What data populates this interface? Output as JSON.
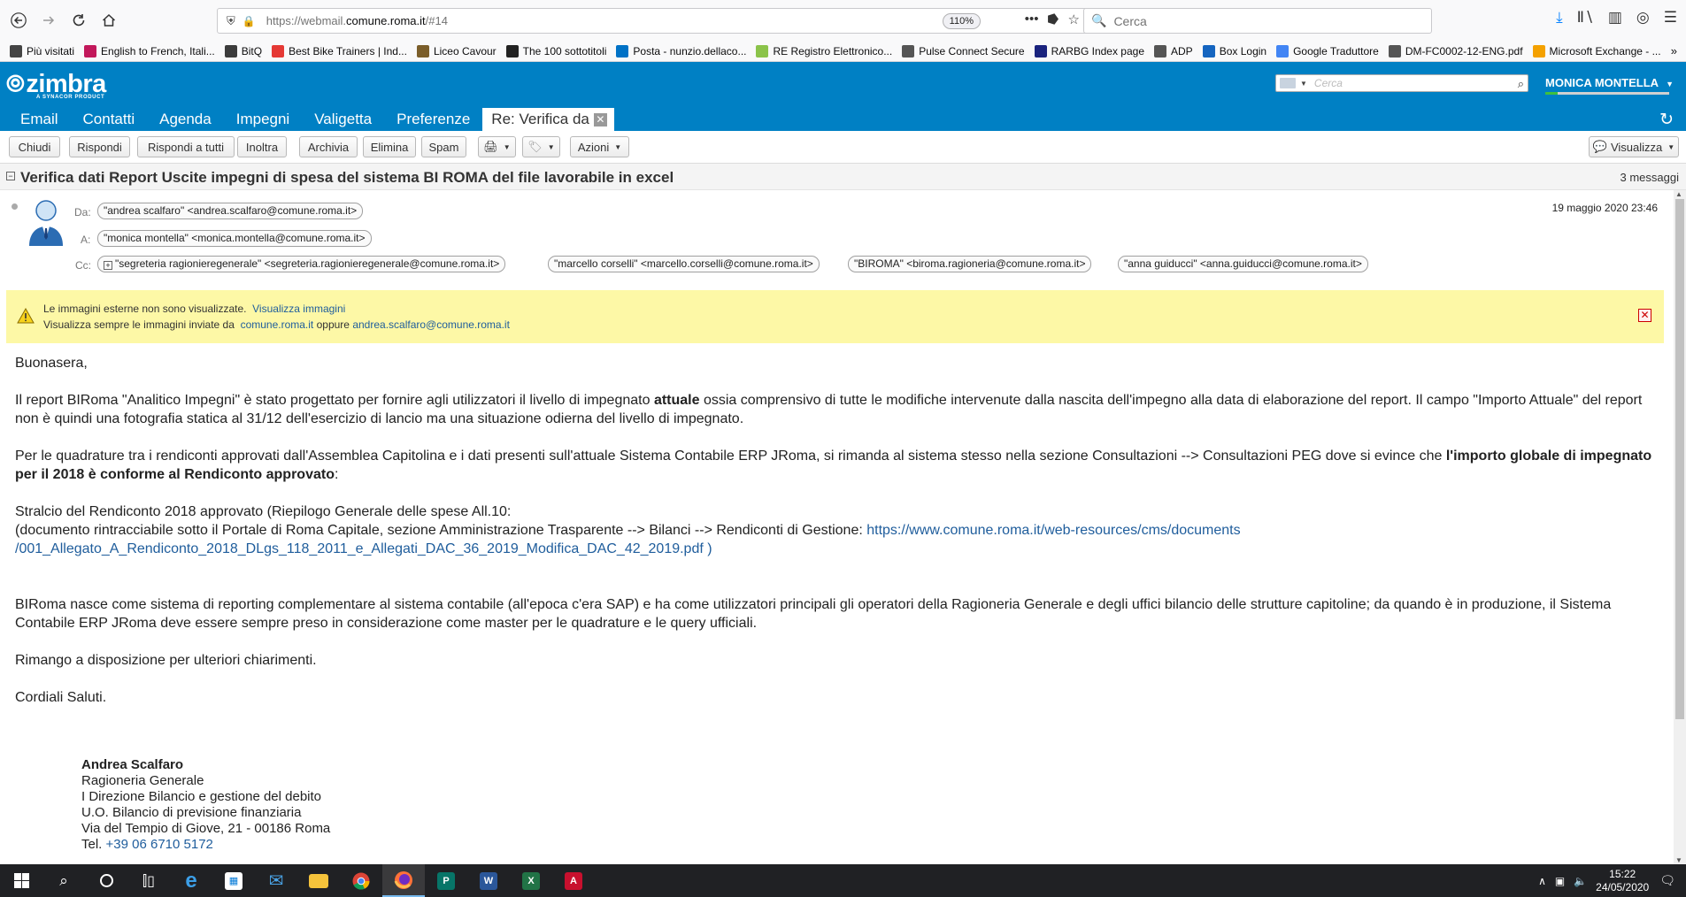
{
  "browser": {
    "url_prefix": "https://webmail.",
    "url_domain": "comune.roma.it",
    "url_suffix": "/#14",
    "zoom": "110%",
    "search_placeholder": "Cerca"
  },
  "bookmarks": [
    {
      "label": "Più visitati",
      "icon_color": "#444444"
    },
    {
      "label": "English to French, Itali...",
      "icon_color": "#c2185b"
    },
    {
      "label": "BitQ",
      "icon_color": "#3c3c3c"
    },
    {
      "label": "Best Bike Trainers | Ind...",
      "icon_color": "#e53935"
    },
    {
      "label": "Liceo Cavour",
      "icon_color": "#7b5e2a"
    },
    {
      "label": "The 100 sottotitoli",
      "icon_color": "#222222"
    },
    {
      "label": "Posta - nunzio.dellaco...",
      "icon_color": "#0072c6"
    },
    {
      "label": "RE Registro Elettronico...",
      "icon_color": "#8bc34a"
    },
    {
      "label": "Pulse Connect Secure",
      "icon_color": "#555555"
    },
    {
      "label": "RARBG Index page",
      "icon_color": "#1a237e"
    },
    {
      "label": "ADP",
      "icon_color": "#555555"
    },
    {
      "label": "Box Login",
      "icon_color": "#1565c0"
    },
    {
      "label": "Google Traduttore",
      "icon_color": "#4285f4"
    },
    {
      "label": "DM-FC0002-12-ENG.pdf",
      "icon_color": "#555555"
    },
    {
      "label": "Microsoft Exchange - ...",
      "icon_color": "#f4a100"
    }
  ],
  "zimbra": {
    "logo": "zimbra",
    "logo_sub": "A SYNACOR PRODUCT",
    "search_placeholder": "Cerca",
    "user": "MONICA MONTELLA",
    "tabs": [
      "Email",
      "Contatti",
      "Agenda",
      "Impegni",
      "Valigetta",
      "Preferenze"
    ],
    "active_tab": "Re: Verifica da",
    "actions": [
      "Chiudi",
      "Rispondi",
      "Rispondi a tutti",
      "Inoltra",
      "Archivia",
      "Elimina",
      "Spam"
    ],
    "azioni": "Azioni",
    "visualizza": "Visualizza"
  },
  "conversation": {
    "subject": "Verifica dati Report Uscite impegni di spesa del sistema BI ROMA del file lavorabile in excel",
    "count": "3 messaggi",
    "labels": {
      "from": "Da:",
      "to": "A:",
      "cc": "Cc:"
    },
    "from": "\"andrea scalfaro\" <andrea.scalfaro@comune.roma.it>",
    "to": "\"monica montella\" <monica.montella@comune.roma.it>",
    "cc": [
      "\"segreteria ragionieregenerale\" <segreteria.ragionieregenerale@comune.roma.it>",
      "\"marcello corselli\" <marcello.corselli@comune.roma.it>",
      "\"BIROMA\" <biroma.ragioneria@comune.roma.it>",
      "\"anna guiducci\" <anna.guiducci@comune.roma.it>"
    ],
    "date": "19 maggio 2020 23:46"
  },
  "warning": {
    "line1": "Le immagini esterne non sono visualizzate.",
    "link1": "Visualizza immagini",
    "line2": "Visualizza sempre le immagini inviate da",
    "link2": "comune.roma.it",
    "or": "oppure",
    "link3": "andrea.scalfaro@comune.roma.it"
  },
  "body": {
    "greeting": "Buonasera,",
    "p1a": "Il report BIRoma \"Analitico Impegni\" è stato progettato per fornire agli utilizzatori il livello di impegnato ",
    "p1b": "attuale",
    "p1c": " ossia comprensivo di tutte le modifiche intervenute dalla nascita dell'impegno alla data di elaborazione del report. Il campo \"Importo Attuale\" del report non è quindi una fotografia statica al 31/12 dell'esercizio di lancio ma una situazione odierna del livello di impegnato.",
    "p2a": "Per le quadrature tra i rendiconti approvati dall'Assemblea Capitolina e i dati presenti sull'attuale Sistema Contabile ERP JRoma, si rimanda al sistema stesso nella sezione Consultazioni --> Consultazioni PEG dove si evince che ",
    "p2b": "l'importo globale di impegnato per il 2018 è conforme al Rendiconto approvato",
    "p2c": ":",
    "p3a": "Stralcio del Rendiconto 2018 approvato (Riepilogo Generale delle spese All.10:",
    "p3b": "(documento rintracciabile sotto il Portale di Roma Capitale, sezione Amministrazione Trasparente --> Bilanci --> Rendiconti di Gestione: ",
    "p3link1": "https://www.comune.roma.it/web-resources/cms/documents",
    "p3link2": "/001_Allegato_A_Rendiconto_2018_DLgs_118_2011_e_Allegati_DAC_36_2019_Modifica_DAC_42_2019.pdf )",
    "p4": "BIRoma nasce come sistema di reporting complementare al sistema contabile (all'epoca c'era SAP) e ha come utilizzatori principali gli operatori della Ragioneria Generale e degli uffici bilancio delle strutture capitoline; da quando è in produzione, il Sistema Contabile ERP JRoma deve essere sempre preso in considerazione come master per le quadrature e le query ufficiali.",
    "p5": "Rimango a disposizione per ulteriori chiarimenti.",
    "p6": "Cordiali Saluti."
  },
  "signature": {
    "name": "Andrea Scalfaro",
    "l1": "Ragioneria Generale",
    "l2": "I Direzione Bilancio e gestione del debito",
    "l3": "U.O. Bilancio di previsione finanziaria",
    "l4": "Via del Tempio di Giove, 21 - 00186 Roma",
    "tel_label": "Tel.",
    "tel": "+39 06 6710 5172"
  },
  "taskbar": {
    "time": "15:22",
    "date": "24/05/2020"
  }
}
